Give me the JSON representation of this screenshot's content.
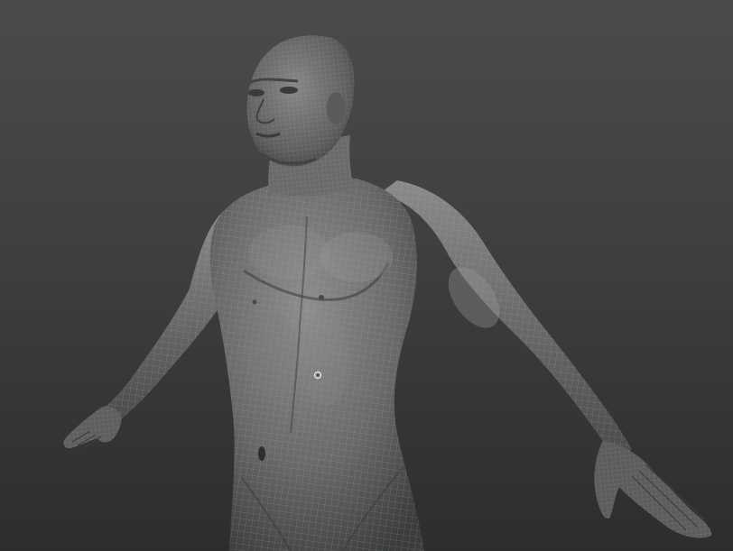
{
  "viewport": {
    "background_top": "#4b4b4b",
    "background_bottom": "#2d2d2d",
    "display_mode": "polyframe-wireframe-over-matcap",
    "wire_color": "#9ab6c4",
    "skin_color": "#6e6e6e"
  },
  "model": {
    "subject": "human-male-base-mesh",
    "pose": "a-pose"
  },
  "cursor": {
    "icon": "brush-cursor-icon"
  }
}
